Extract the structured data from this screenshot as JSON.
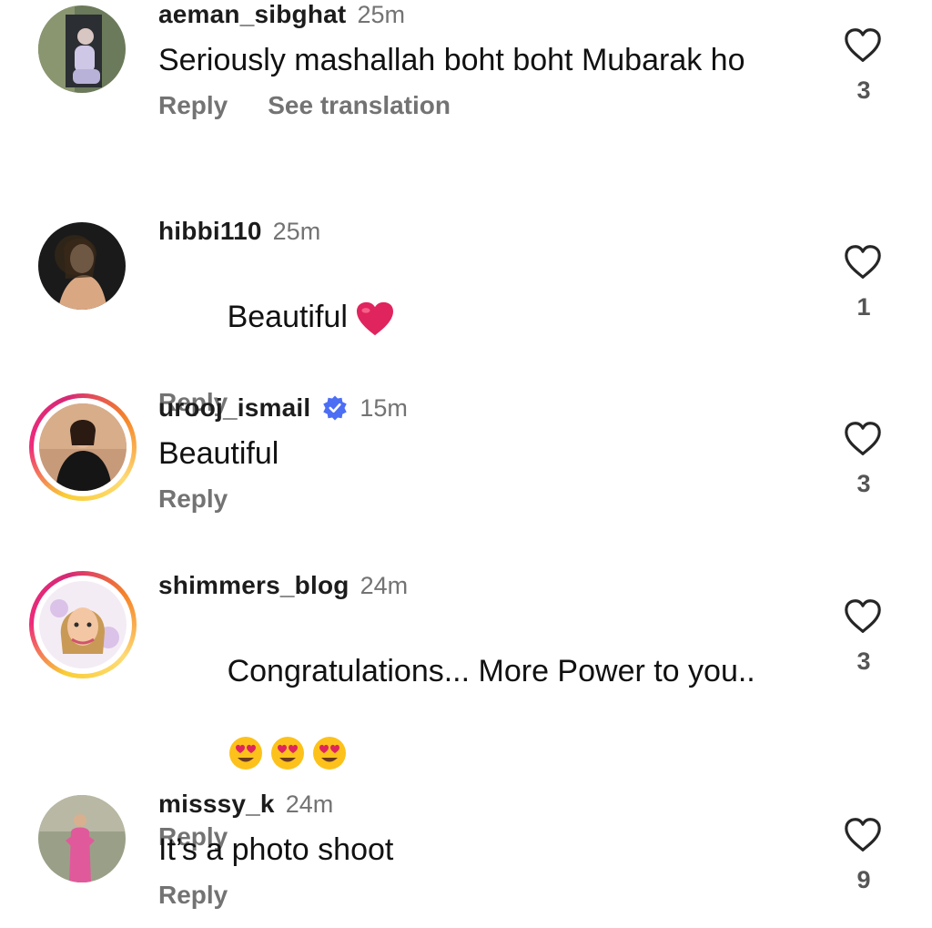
{
  "comments": [
    {
      "username": "aeman_sibghat",
      "time": "25m",
      "text": "Seriously mashallah boht boht Mubarak ho",
      "reply_label": "Reply",
      "translate_label": "See translation",
      "like_count": "3",
      "avatar_icon": "user-photo-avatar"
    },
    {
      "username": "hibbi110",
      "time": "25m",
      "text": "Beautiful",
      "emoji": "red-heart-emoji",
      "reply_label": "Reply",
      "like_count": "1",
      "avatar_icon": "user-photo-avatar"
    },
    {
      "username": "urooj_ismail",
      "verified": true,
      "time": "15m",
      "text": "Beautiful",
      "reply_label": "Reply",
      "like_count": "3",
      "avatar_icon": "story-ring-avatar"
    },
    {
      "username": "shimmers_blog",
      "time": "24m",
      "text": "Congratulations... More Power to you..",
      "emoji": "heart-eyes-emoji x3",
      "reply_label": "Reply",
      "like_count": "3",
      "avatar_icon": "story-ring-avatar"
    },
    {
      "username": "misssy_k",
      "time": "24m",
      "text": "It’s a photo shoot",
      "reply_label": "Reply",
      "like_count": "9",
      "avatar_icon": "user-photo-avatar"
    }
  ],
  "colors": {
    "username": "#1c1c1c",
    "meta_gray": "#737373",
    "verified_blue": "#3897f0",
    "heart_emoji": "#e0245e",
    "story_ring": "#ee2a7b"
  }
}
